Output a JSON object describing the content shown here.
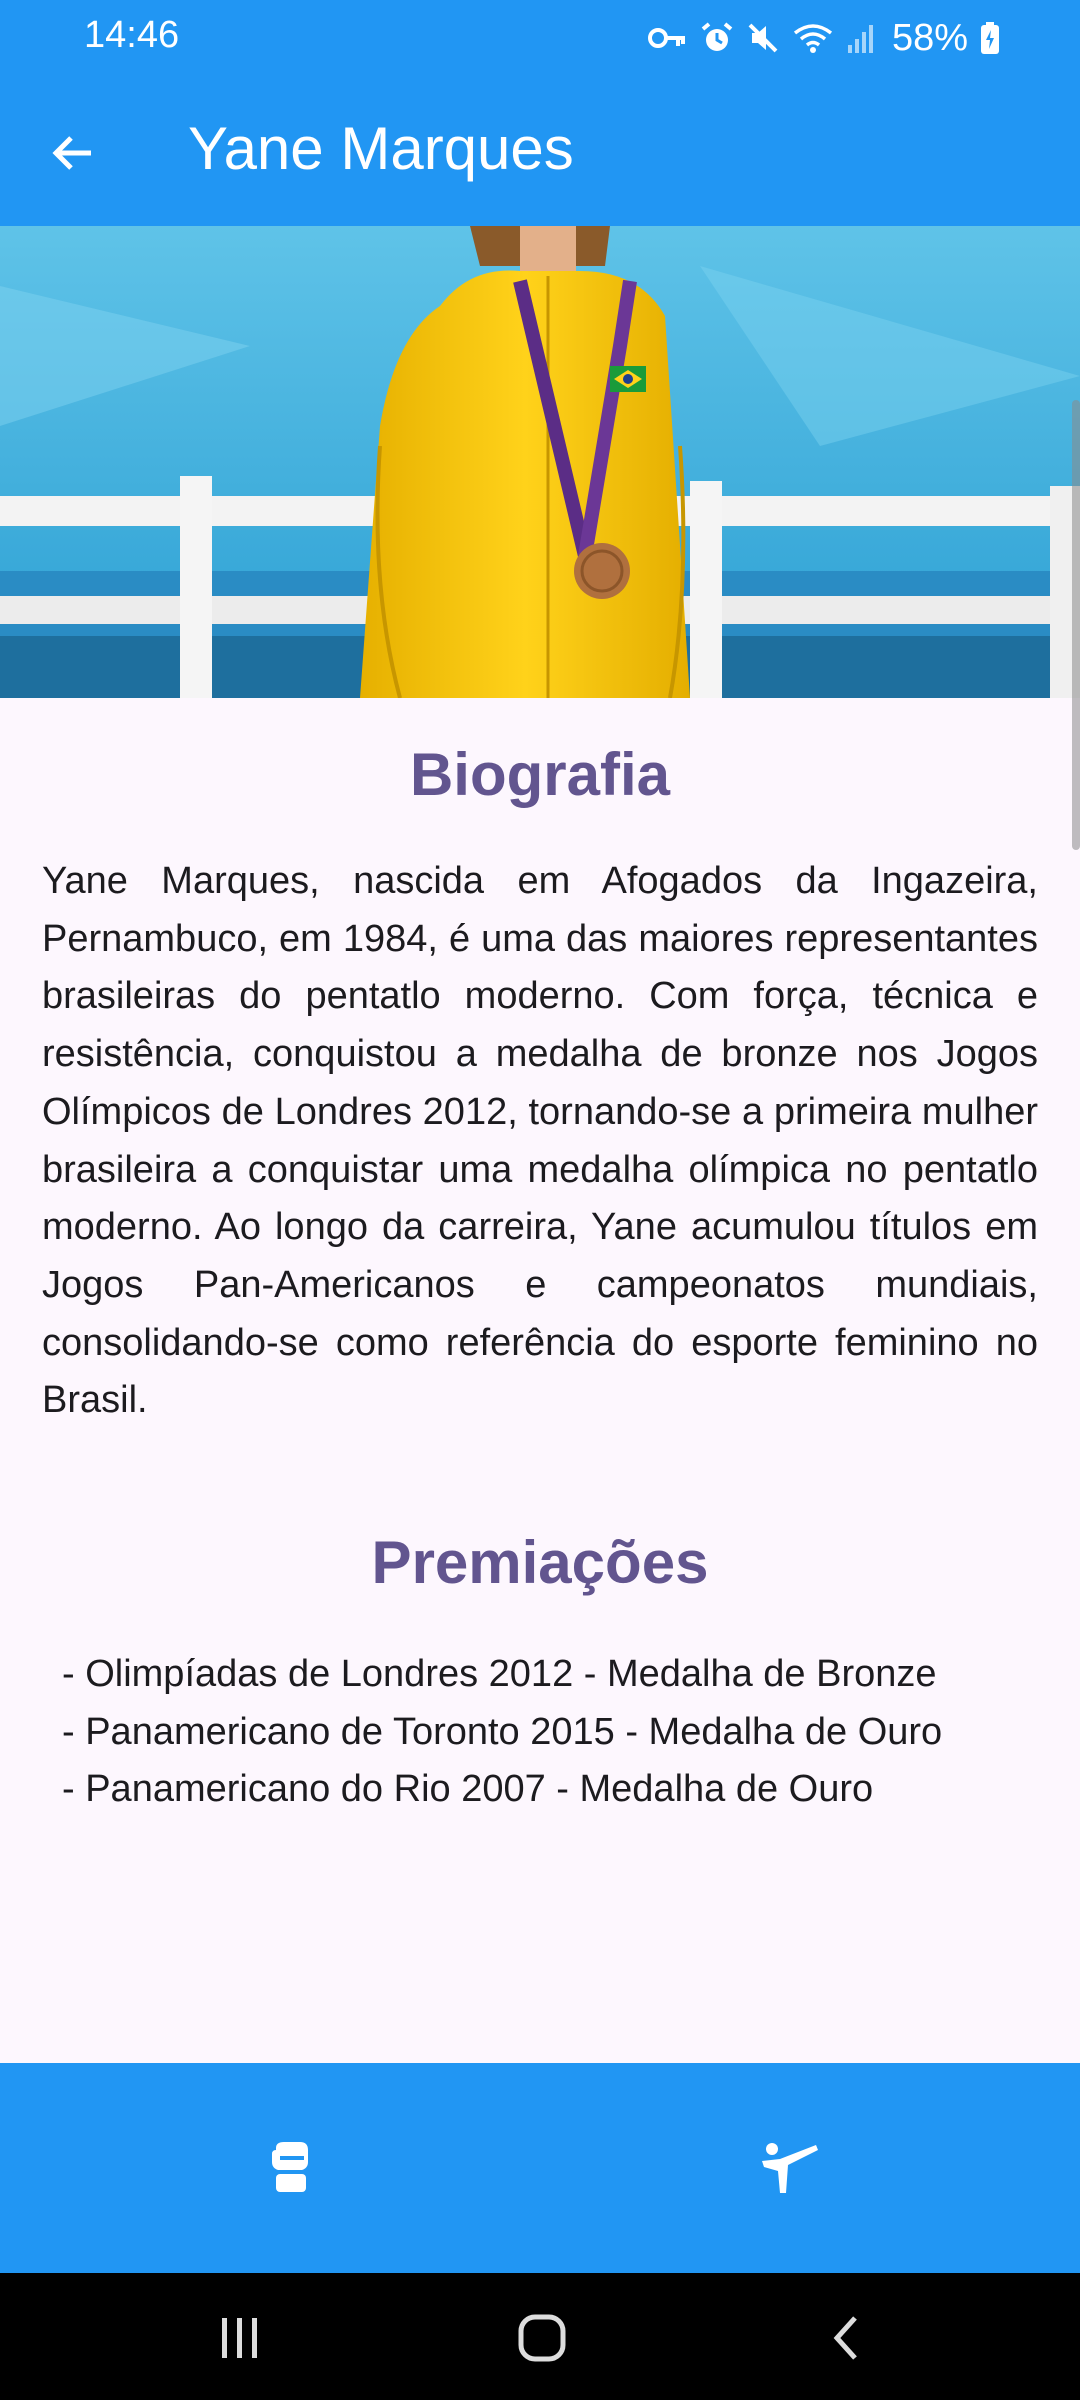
{
  "status_bar": {
    "time": "14:46",
    "battery": "58%",
    "icons": [
      "vpn-key-icon",
      "alarm-icon",
      "mute-icon",
      "wifi-icon",
      "signal-icon",
      "battery-charging-icon"
    ]
  },
  "app_bar": {
    "title": "Yane Marques",
    "back_icon": "arrow-back-icon"
  },
  "bio": {
    "title": "Biografia",
    "text": "Yane Marques, nascida em Afogados da Ingazeira, Pernambuco, em 1984, é uma das maiores representantes brasileiras do pentatlo moderno. Com força, técnica e resistência, conquistou a medalha de bronze nos Jogos Olímpicos de Londres 2012, tornando-se a primeira mulher brasileira a conquistar uma medalha olímpica no pentatlo moderno. Ao longo da carreira, Yane acumulou títulos em Jogos Pan-Americanos e campeonatos mundiais, consolidando-se como referência do esporte feminino no Brasil."
  },
  "awards": {
    "title": "Premiações",
    "items": [
      "- Olimpíadas de Londres 2012 - Medalha de Bronze",
      "- Panamericano de Toronto 2015 - Medalha de Ouro",
      "- Panamericano do Rio 2007 - Medalha de Ouro"
    ]
  },
  "bottom_nav": {
    "items": [
      {
        "icon": "boxing-glove-icon"
      },
      {
        "icon": "martial-arts-kick-icon"
      }
    ]
  },
  "colors": {
    "primary": "#2196f3",
    "title_purple": "#62558f",
    "background": "#fdf7fe",
    "text": "#1c1b1f"
  }
}
